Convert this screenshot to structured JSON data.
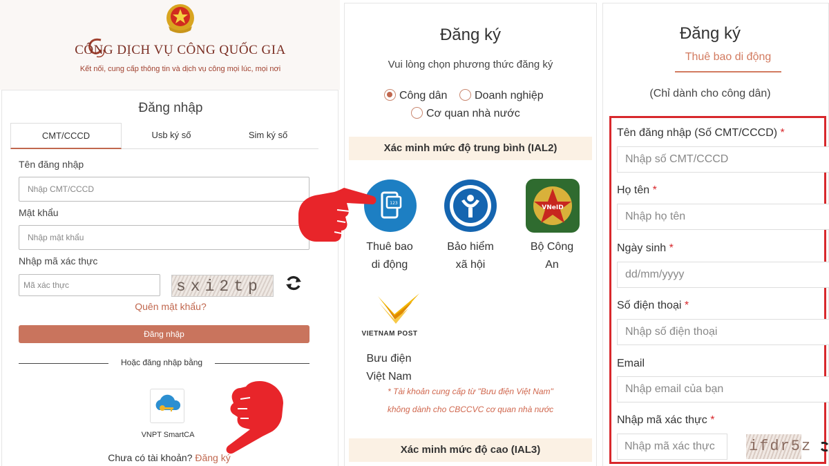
{
  "left": {
    "portal_title": "CỔNG DỊCH VỤ CÔNG QUỐC GIA",
    "portal_subtitle": "Kết nối, cung cấp thông tin và dịch vụ công mọi lúc, mọi nơi",
    "login_title": "Đăng nhập",
    "tabs": [
      {
        "label": "CMT/CCCD",
        "active": true
      },
      {
        "label": "Usb ký số",
        "active": false
      },
      {
        "label": "Sim ký số",
        "active": false
      }
    ],
    "username_label": "Tên đăng nhập",
    "username_placeholder": "Nhập CMT/CCCD",
    "password_label": "Mật khẩu",
    "password_placeholder": "Nhập mật khẩu",
    "captcha_label": "Nhập mã xác thực",
    "captcha_placeholder": "Mã xác thực",
    "captcha_text": "sxi2tp",
    "forgot_password": "Quên mật khẩu?",
    "login_button": "Đăng nhập",
    "or_login_with": "Hoặc đăng nhập bằng",
    "vnpt_label": "VNPT SmartCA",
    "no_account_text": "Chưa có tài khoản?",
    "register_link": "Đăng ký"
  },
  "middle": {
    "title": "Đăng ký",
    "subtitle": "Vui lòng chọn phương thức đăng ký",
    "radios": [
      {
        "label": "Công dân",
        "checked": true
      },
      {
        "label": "Doanh nghiệp",
        "checked": false
      },
      {
        "label": "Cơ quan nhà nước",
        "checked": false
      }
    ],
    "ial2_header": "Xác minh mức độ trung bình (IAL2)",
    "methods": [
      {
        "line1": "Thuê bao",
        "line2": "di động",
        "icon": "phone-sim-icon"
      },
      {
        "line1": "Bảo hiểm",
        "line2": "xã hội",
        "icon": "social-insurance-icon"
      },
      {
        "line1": "Bộ Công",
        "line2": "An",
        "icon": "vneid-icon"
      },
      {
        "line1": "Bưu điện",
        "line2": "Việt Nam",
        "icon": "vietnam-post-icon"
      }
    ],
    "vietnam_post_logo": "VIETNAM POST",
    "note_line1": "* Tài khoản cung cấp từ \"Bưu điện Việt Nam\"",
    "note_line2": "không dành cho CBCCVC cơ quan nhà nước",
    "ial3_header": "Xác minh mức độ cao (IAL3)"
  },
  "right": {
    "title": "Đăng ký",
    "tab_label": "Thuê bao di động",
    "note": "(Chỉ dành cho công dân)",
    "fields": [
      {
        "label": "Tên đăng nhập (Số CMT/CCCD)",
        "required": "*",
        "placeholder": "Nhập số CMT/CCCD"
      },
      {
        "label": "Họ tên",
        "required": "*",
        "placeholder": "Nhập họ tên"
      },
      {
        "label": "Ngày sinh",
        "required": "*",
        "placeholder": "dd/mm/yyyy"
      },
      {
        "label": "Số điện thoại",
        "required": "*",
        "placeholder": "Nhập số điện thoại"
      },
      {
        "label": "Email",
        "required": "",
        "placeholder": "Nhập email của bạn"
      }
    ],
    "captcha_label": "Nhập mã xác thực",
    "captcha_required": "*",
    "captcha_placeholder": "Nhập mã xác thực",
    "captcha_text": "ifdr5z"
  },
  "colors": {
    "accent": "#c0674e",
    "highlight_border": "#d8282c",
    "hand": "#e8252a"
  }
}
